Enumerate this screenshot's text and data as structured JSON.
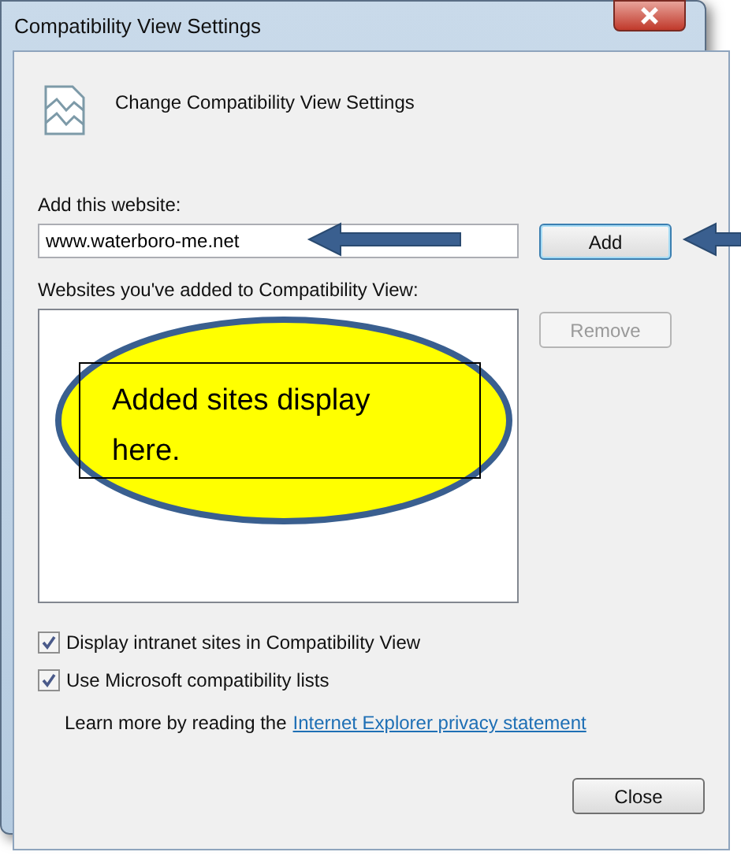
{
  "window": {
    "title": "Compatibility View Settings"
  },
  "header": "Change Compatibility View Settings",
  "add_label": "Add this website:",
  "website_field": {
    "value": "www.waterboro-me.net"
  },
  "add_button": {
    "label": "Add",
    "disabled": false
  },
  "list_label": "Websites you've added to Compatibility View:",
  "remove_button": {
    "label": "Remove",
    "disabled": true
  },
  "options": [
    {
      "label": "Display intranet sites in Compatibility View",
      "checked": true
    },
    {
      "label": "Use Microsoft compatibility lists",
      "checked": true
    }
  ],
  "learn_more": {
    "text": "Learn more by reading the",
    "link": "Internet Explorer privacy statement"
  },
  "close_button": {
    "label": "Close",
    "disabled": false
  },
  "annotation": {
    "text": "Added sites display here."
  }
}
